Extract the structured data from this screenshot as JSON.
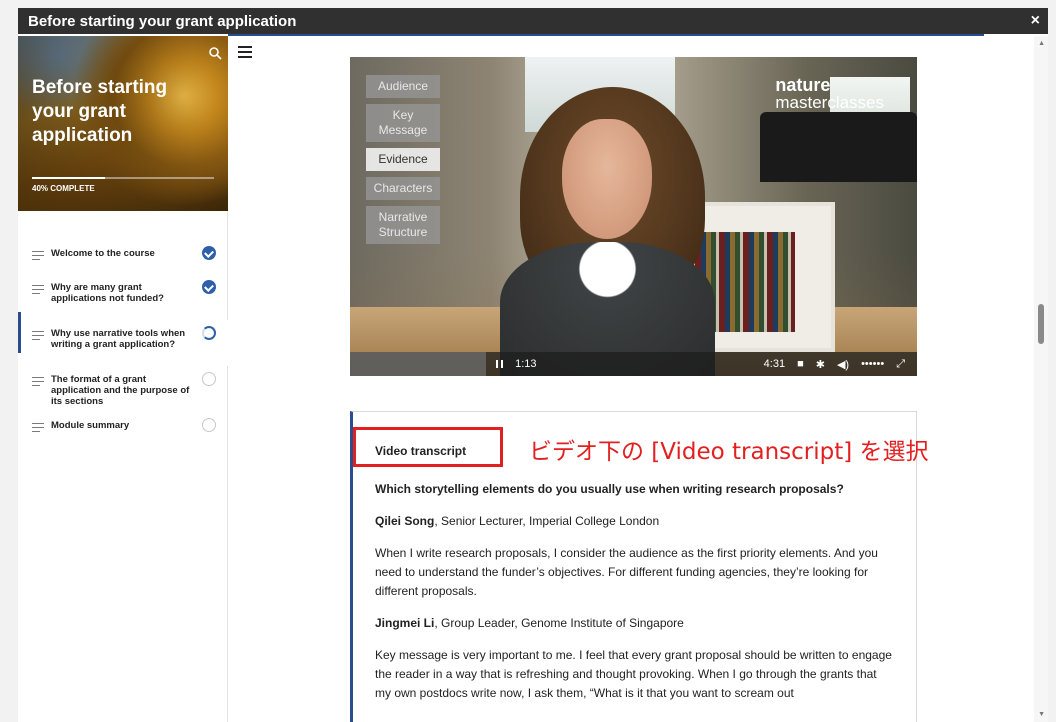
{
  "window": {
    "title": "Before starting your grant application",
    "close_icon": "×"
  },
  "sidebar": {
    "hero_title": "Before starting your grant application",
    "progress_label": "40% COMPLETE",
    "progress_percent": 40,
    "items": [
      {
        "label": "Welcome to the course",
        "status": "complete"
      },
      {
        "label": "Why are many grant applications not funded?",
        "status": "complete"
      },
      {
        "label": "Why use narrative tools when writing a grant application?",
        "status": "in-progress",
        "active": true
      },
      {
        "label": "The format of a grant application and the purpose of its sections",
        "status": "not-started"
      },
      {
        "label": "Module summary",
        "status": "not-started"
      }
    ]
  },
  "video": {
    "menu": [
      "Audience",
      "Key Message",
      "Evidence",
      "Characters",
      "Narrative Structure"
    ],
    "selected": "Evidence",
    "brand_line1": "nature",
    "brand_line2": "masterclasses",
    "current_time": "1:13",
    "duration": "4:31",
    "played_fraction": 0.24,
    "volume_dots": "••••••"
  },
  "transcript": {
    "heading": "Video transcript",
    "question": "Which storytelling elements do you usually use when writing research proposals?",
    "speaker1_name": "Qilei Song",
    "speaker1_role": ", Senior Lecturer, Imperial College London",
    "speaker1_text": "When I write research proposals, I consider the audience as the first priority elements. And you need to understand the funder’s objectives. For different funding agencies, they’re looking for different proposals.",
    "speaker2_name": "Jingmei Li",
    "speaker2_role": ", Group Leader, Genome Institute of Singapore",
    "speaker2_text": "Key message is very important to me. I feel that every grant proposal should be written to engage the reader in a way that is refreshing and thought provoking. When I go through the grants that my own postdocs write now, I ask them, “What is it that you want to scream out"
  },
  "annotation": "ビデオ下の [Video transcript] を選択",
  "colors": {
    "accent": "#2a4d8f",
    "annotation_red": "#e32020",
    "titlebar": "#303030"
  }
}
